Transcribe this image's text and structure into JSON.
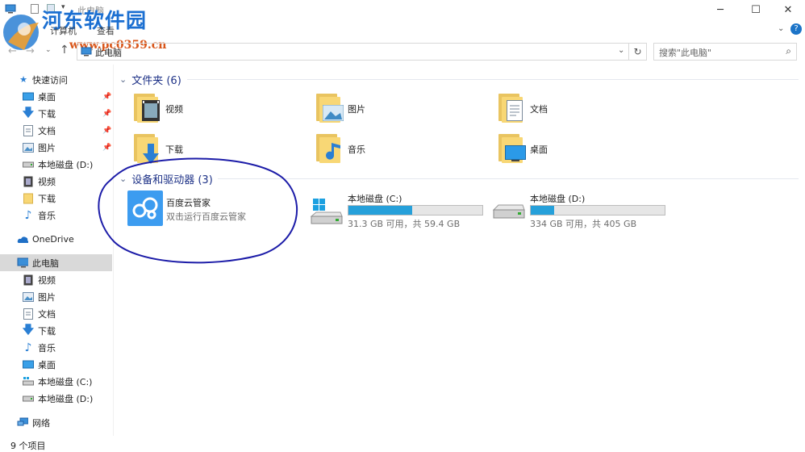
{
  "window": {
    "title": "此电脑",
    "controls": {
      "minimize": "─",
      "maximize": "☐",
      "close": "✕"
    }
  },
  "watermark": {
    "name": "河东软件园",
    "url": "www.pc0359.cn"
  },
  "ribbon": {
    "tabs": [
      "计算机",
      "查看"
    ]
  },
  "address": {
    "path": "此电脑",
    "refresh": "↻"
  },
  "search": {
    "placeholder": "搜索\"此电脑\""
  },
  "sidebar": {
    "quick_access": "快速访问",
    "pinned": [
      {
        "label": "桌面"
      },
      {
        "label": "下载"
      },
      {
        "label": "文档"
      },
      {
        "label": "图片"
      }
    ],
    "recent": [
      {
        "label": "本地磁盘 (D:)"
      },
      {
        "label": "视频"
      },
      {
        "label": "下载"
      },
      {
        "label": "音乐"
      }
    ],
    "onedrive": "OneDrive",
    "this_pc": "此电脑",
    "pc_items": [
      {
        "label": "视频"
      },
      {
        "label": "图片"
      },
      {
        "label": "文档"
      },
      {
        "label": "下载"
      },
      {
        "label": "音乐"
      },
      {
        "label": "桌面"
      },
      {
        "label": "本地磁盘 (C:)"
      },
      {
        "label": "本地磁盘 (D:)"
      }
    ],
    "network": "网络"
  },
  "folders_section": {
    "title": "文件夹 (6)",
    "items": [
      {
        "label": "视频"
      },
      {
        "label": "图片"
      },
      {
        "label": "文档"
      },
      {
        "label": "下载"
      },
      {
        "label": "音乐"
      },
      {
        "label": "桌面"
      }
    ]
  },
  "devices_section": {
    "title": "设备和驱动器 (3)",
    "baidu": {
      "title": "百度云管家",
      "subtitle": "双击运行百度云管家"
    },
    "drives": [
      {
        "title": "本地磁盘 (C:)",
        "free": "31.3 GB 可用，共 59.4 GB",
        "used_fraction": 0.473
      },
      {
        "title": "本地磁盘 (D:)",
        "free": "334 GB 可用，共 405 GB",
        "used_fraction": 0.175
      }
    ]
  },
  "status": {
    "count": "9 个项目"
  },
  "colors": {
    "accent": "#26a0da",
    "section_title": "#1e3287",
    "annotation": "#1c1ca8",
    "selected": "#d9d9d9"
  }
}
